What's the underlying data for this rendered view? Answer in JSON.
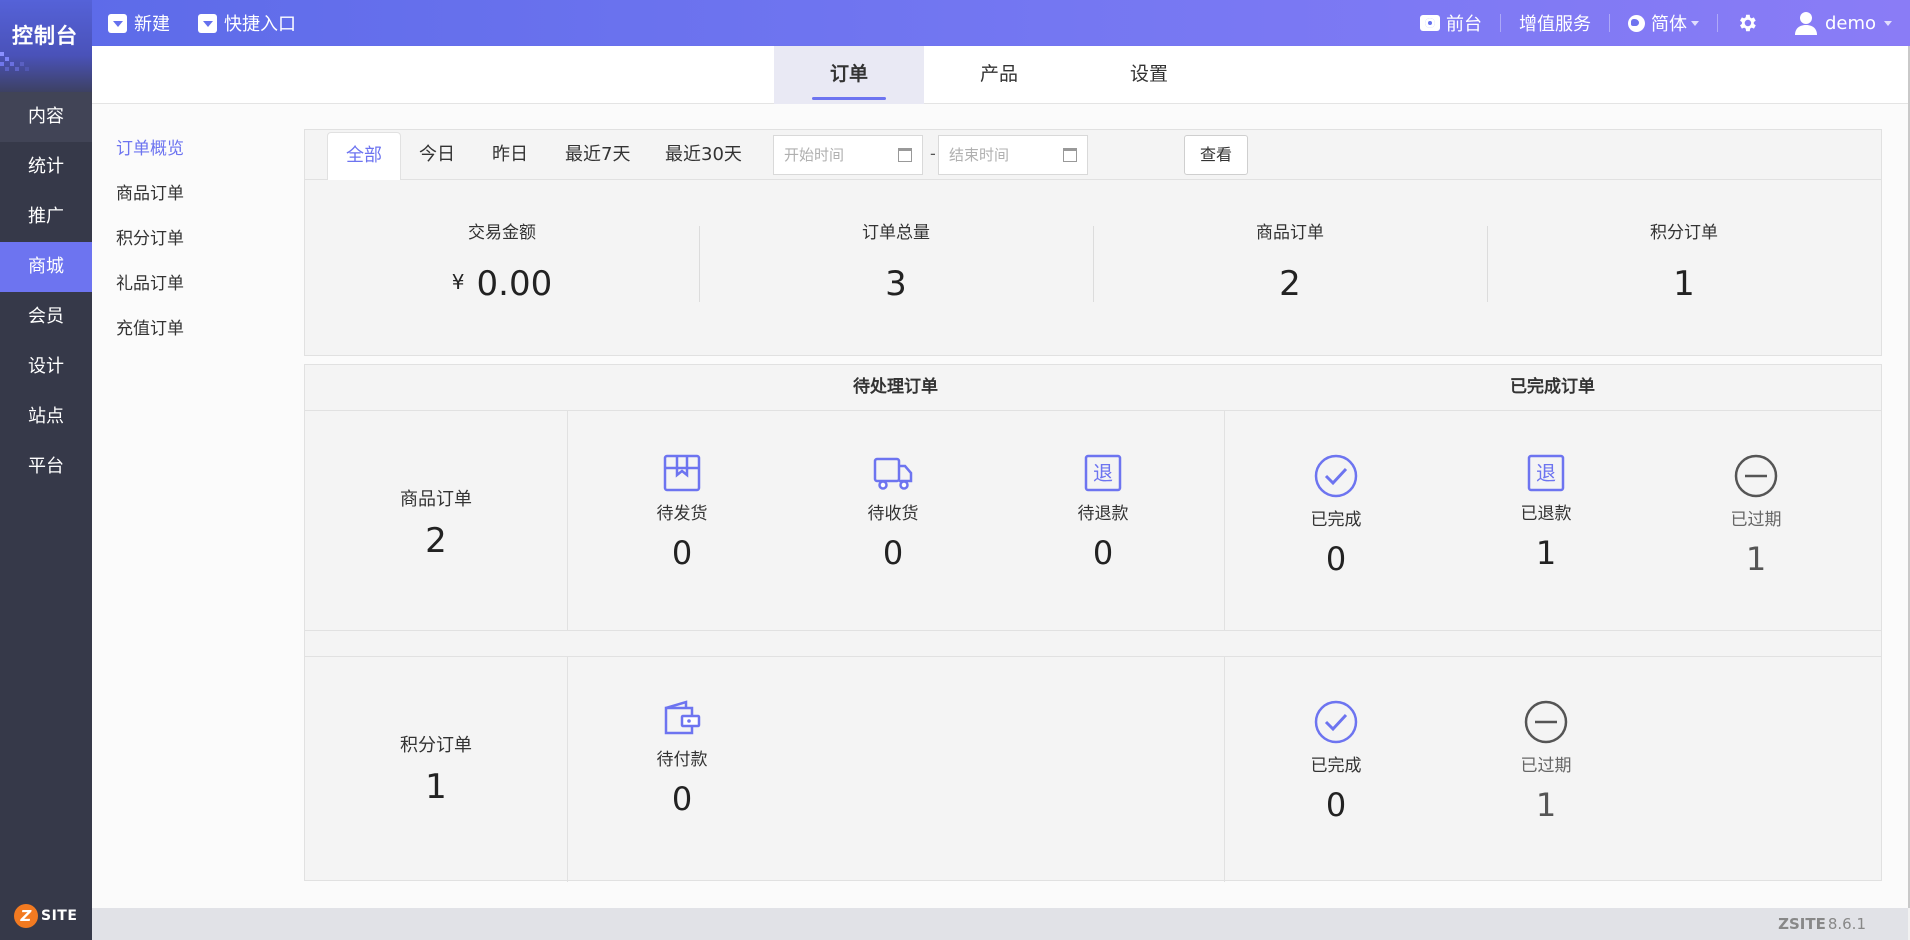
{
  "app": {
    "logo_text": "控制台"
  },
  "topbar": {
    "new_label": "新建",
    "shortcut_label": "快捷入口",
    "frontend_label": "前台",
    "value_added_label": "增值服务",
    "language_label": "简体",
    "user_label": "demo"
  },
  "sidebar": {
    "items": [
      {
        "label": "内容"
      },
      {
        "label": "统计"
      },
      {
        "label": "推广"
      },
      {
        "label": "商城"
      },
      {
        "label": "会员"
      },
      {
        "label": "设计"
      },
      {
        "label": "站点"
      },
      {
        "label": "平台"
      }
    ],
    "active_index": 3,
    "brand": {
      "badge": "Z",
      "word": "SITE"
    }
  },
  "main_tabs": [
    {
      "label": "订单"
    },
    {
      "label": "产品"
    },
    {
      "label": "设置"
    }
  ],
  "subnav": [
    {
      "label": "订单概览"
    },
    {
      "label": "商品订单"
    },
    {
      "label": "积分订单"
    },
    {
      "label": "礼品订单"
    },
    {
      "label": "充值订单"
    }
  ],
  "filter": {
    "tabs": [
      {
        "label": "全部"
      },
      {
        "label": "今日"
      },
      {
        "label": "昨日"
      },
      {
        "label": "最近7天"
      },
      {
        "label": "最近30天"
      }
    ],
    "start_placeholder": "开始时间",
    "separator": "-",
    "end_placeholder": "结束时间",
    "view_button": "查看"
  },
  "stats": [
    {
      "label": "交易金额",
      "currency": "¥",
      "value": "0.00"
    },
    {
      "label": "订单总量",
      "value": "3"
    },
    {
      "label": "商品订单",
      "value": "2"
    },
    {
      "label": "积分订单",
      "value": "1"
    }
  ],
  "status_panel": {
    "pending_title": "待处理订单",
    "completed_title": "已完成订单",
    "product_row": {
      "label": "商品订单",
      "count": "2",
      "pending": [
        {
          "label": "待发货",
          "value": "0",
          "icon": "package-icon"
        },
        {
          "label": "待收货",
          "value": "0",
          "icon": "truck-icon"
        },
        {
          "label": "待退款",
          "value": "0",
          "icon": "refund-icon",
          "glyph": "退"
        }
      ],
      "completed": [
        {
          "label": "已完成",
          "value": "0",
          "icon": "check-circle-icon"
        },
        {
          "label": "已退款",
          "value": "1",
          "icon": "refund-icon",
          "glyph": "退"
        },
        {
          "label": "已过期",
          "value": "1",
          "icon": "minus-circle-icon"
        }
      ]
    },
    "points_row": {
      "label": "积分订单",
      "count": "1",
      "pending": [
        {
          "label": "待付款",
          "value": "0",
          "icon": "wallet-icon"
        }
      ],
      "completed": [
        {
          "label": "已完成",
          "value": "0",
          "icon": "check-circle-icon"
        },
        {
          "label": "已过期",
          "value": "1",
          "icon": "minus-circle-icon"
        }
      ]
    }
  },
  "footer": {
    "brand": "ZSITE",
    "version": "8.6.1"
  },
  "colors": {
    "accent": "#6d74f0",
    "sidebar": "#363949",
    "expired": "#555555"
  }
}
